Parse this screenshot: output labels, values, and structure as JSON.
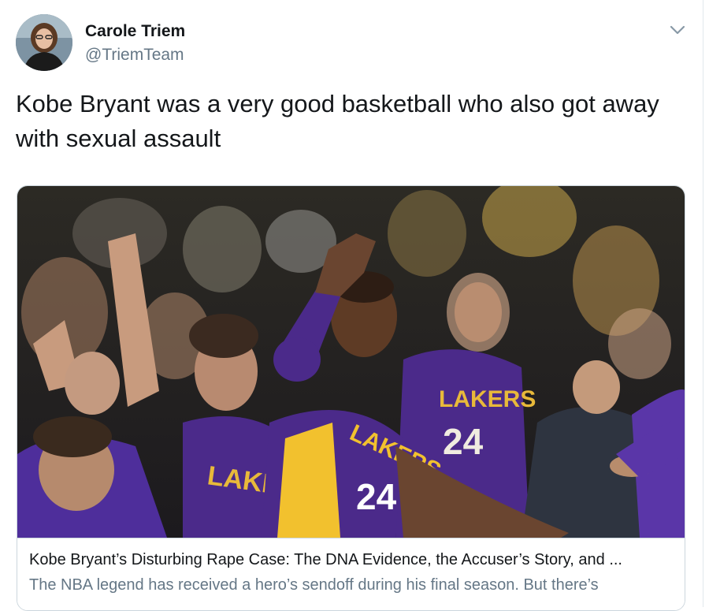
{
  "author": {
    "display_name": "Carole Triem",
    "handle": "@TriemTeam"
  },
  "tweet": {
    "text": "Kobe Bryant was a very good basketball who also got away with sexual assault"
  },
  "card": {
    "title": "Kobe Bryant’s Disturbing Rape Case: The DNA Evidence, the Accuser’s Story, and ...",
    "description": "The NBA legend has received a hero’s sendoff during his final season. But there’s",
    "jersey_text": "LAKERS",
    "jersey_number": "24",
    "crowd_jersey_text": "LAKERS",
    "crowd_jersey_number": "24",
    "bench_jersey_text": "LAKE"
  },
  "colors": {
    "text_primary": "#14171a",
    "text_secondary": "#657786",
    "border": "#ccd6dd",
    "lakers_purple": "#4b2a8a",
    "lakers_gold": "#f2c12e"
  },
  "icons": {
    "caret": "chevron-down-icon"
  }
}
